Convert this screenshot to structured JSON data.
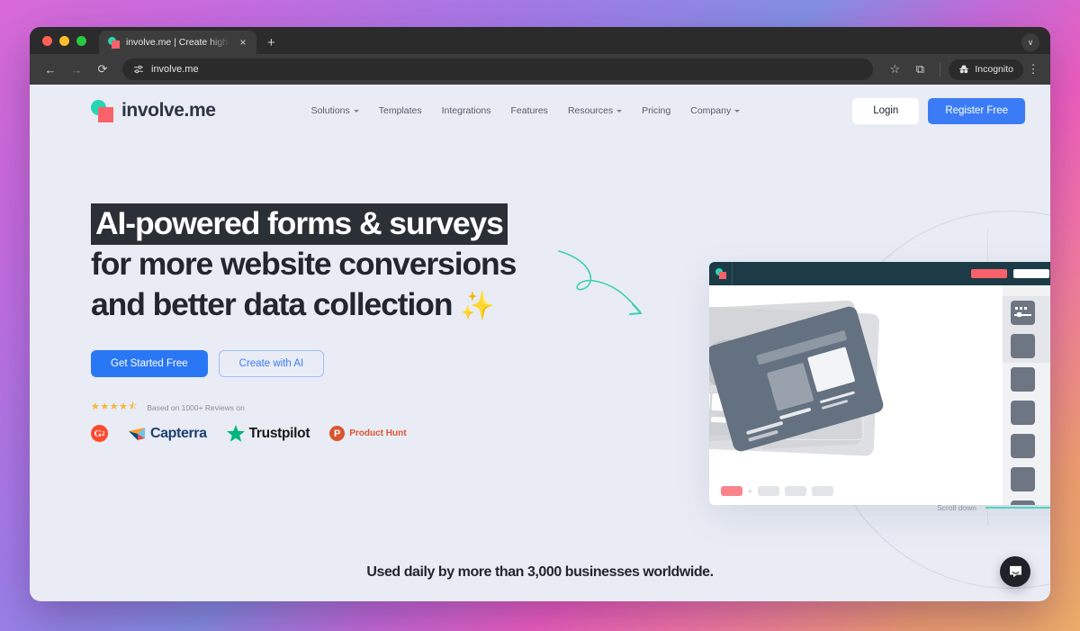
{
  "browser": {
    "tab": {
      "title": "involve.me | Create high-con",
      "favicon": "involveme-favicon-icon",
      "close": "×"
    },
    "new_tab_label": "+",
    "window_chevron": "∨",
    "nav": {
      "back": "←",
      "forward": "→",
      "reload": "⟳"
    },
    "address": {
      "url": "involve.me",
      "site_icon": "tune-settings-icon"
    },
    "toolbar": {
      "bookmark": "☆",
      "extensions": "⧉",
      "incognito_label": "Incognito",
      "incognito_icon": "incognito-hat-icon",
      "menu": "⋮"
    }
  },
  "site": {
    "logo": {
      "text": "involve.me"
    },
    "nav": [
      {
        "label": "Solutions",
        "has_dropdown": true
      },
      {
        "label": "Templates",
        "has_dropdown": false
      },
      {
        "label": "Integrations",
        "has_dropdown": false
      },
      {
        "label": "Features",
        "has_dropdown": false
      },
      {
        "label": "Resources",
        "has_dropdown": true
      },
      {
        "label": "Pricing",
        "has_dropdown": false
      },
      {
        "label": "Company",
        "has_dropdown": true
      }
    ],
    "actions": {
      "login": "Login",
      "register": "Register Free"
    },
    "hero": {
      "title_highlight": "AI-powered forms & surveys",
      "title_line2": "for more website conversions",
      "title_line3": "and better data collection",
      "sparkle": "✨",
      "cta_primary": "Get Started Free",
      "cta_secondary": "Create with AI",
      "stars": "★★★★⯪",
      "rating_text": "Based on 1000+ Reviews on",
      "badges": [
        {
          "name": "G2",
          "mark": "G",
          "superscript": "2"
        },
        {
          "name": "Capterra",
          "label": "Capterra"
        },
        {
          "name": "Trustpilot",
          "label": "Trustpilot"
        },
        {
          "name": "Product Hunt",
          "mark": "P",
          "label": "Product Hunt"
        }
      ]
    },
    "scroll_hint": "Scroll down",
    "bottom_banner": "Used daily by more than 3,000 businesses worldwide.",
    "chat_widget": "chat-bubble-icon"
  },
  "colors": {
    "accent_blue": "#3b7cf6",
    "primary_blue": "#2a77f5",
    "teal": "#25d6b4",
    "salmon": "#f9626b",
    "page_bg": "#e9ecf5",
    "mock_header": "#1d3b47",
    "heading_dark": "#22262f",
    "star_gold": "#f5b731",
    "g2_red": "#ff492c",
    "capterra_navy": "#1c3f72",
    "trustpilot_green": "#00b67a",
    "producthunt_orange": "#da552f"
  }
}
